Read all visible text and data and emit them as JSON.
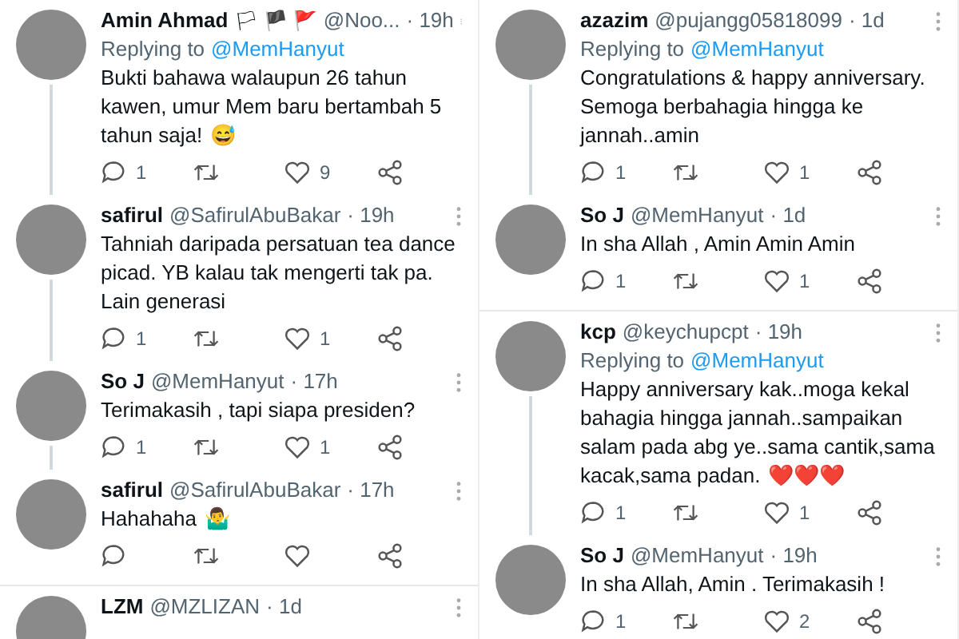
{
  "columns": [
    {
      "tweets": [
        {
          "name": "Amin Ahmad",
          "badges": "🏳 🏴 🚩",
          "handle": "@Noo...",
          "time": "· 19h",
          "replying_label": "Replying to",
          "replying_to": "@MemHanyut",
          "text": "Bukti bahawa walaupun 26 tahun kawen, umur Mem baru bertambah 5 tahun saja!",
          "emoji": "😅",
          "reply_count": "1",
          "like_count": "9",
          "thread": true
        },
        {
          "name": "safirul",
          "handle": "@SafirulAbuBakar",
          "time": "· 19h",
          "text": "Tahniah daripada persatuan tea dance picad. YB kalau tak mengerti tak pa. Lain generasi",
          "reply_count": "1",
          "like_count": "1",
          "thread": true
        },
        {
          "name": "So J",
          "handle": "@MemHanyut",
          "time": "· 17h",
          "text": "Terimakasih , tapi siapa presiden?",
          "reply_count": "1",
          "like_count": "1",
          "thread": true
        },
        {
          "name": "safirul",
          "handle": "@SafirulAbuBakar",
          "time": "· 17h",
          "text": "Hahahaha",
          "emoji": "🤷‍♂️",
          "thread": false
        },
        {
          "name": "LZM",
          "handle": "@MZLIZAN",
          "time": "· 1d",
          "thread": false
        }
      ]
    },
    {
      "tweets": [
        {
          "name": "azazim",
          "handle": "@pujangg05818099",
          "time": "· 1d",
          "replying_label": "Replying to",
          "replying_to": "@MemHanyut",
          "text": "Congratulations & happy anniversary. Semoga berbahagia hingga ke jannah..amin",
          "reply_count": "1",
          "like_count": "1",
          "thread": true
        },
        {
          "name": "So J",
          "handle": "@MemHanyut",
          "time": "· 1d",
          "text": "In sha Allah , Amin Amin Amin",
          "reply_count": "1",
          "like_count": "1",
          "thread": false
        },
        {
          "name": "kcp",
          "handle": "@keychupcpt",
          "time": "· 19h",
          "replying_label": "Replying to",
          "replying_to": "@MemHanyut",
          "text": "Happy anniversary kak..moga kekal bahagia hingga jannah..sampaikan salam pada abg ye..sama cantik,sama kacak,sama padan.",
          "emoji": "❤️❤️❤️",
          "reply_count": "1",
          "like_count": "1",
          "thread": true
        },
        {
          "name": "So J",
          "handle": "@MemHanyut",
          "time": "· 19h",
          "text": "In sha Allah, Amin . Terimakasih !",
          "reply_count": "1",
          "like_count": "2",
          "thread": false
        }
      ]
    }
  ]
}
